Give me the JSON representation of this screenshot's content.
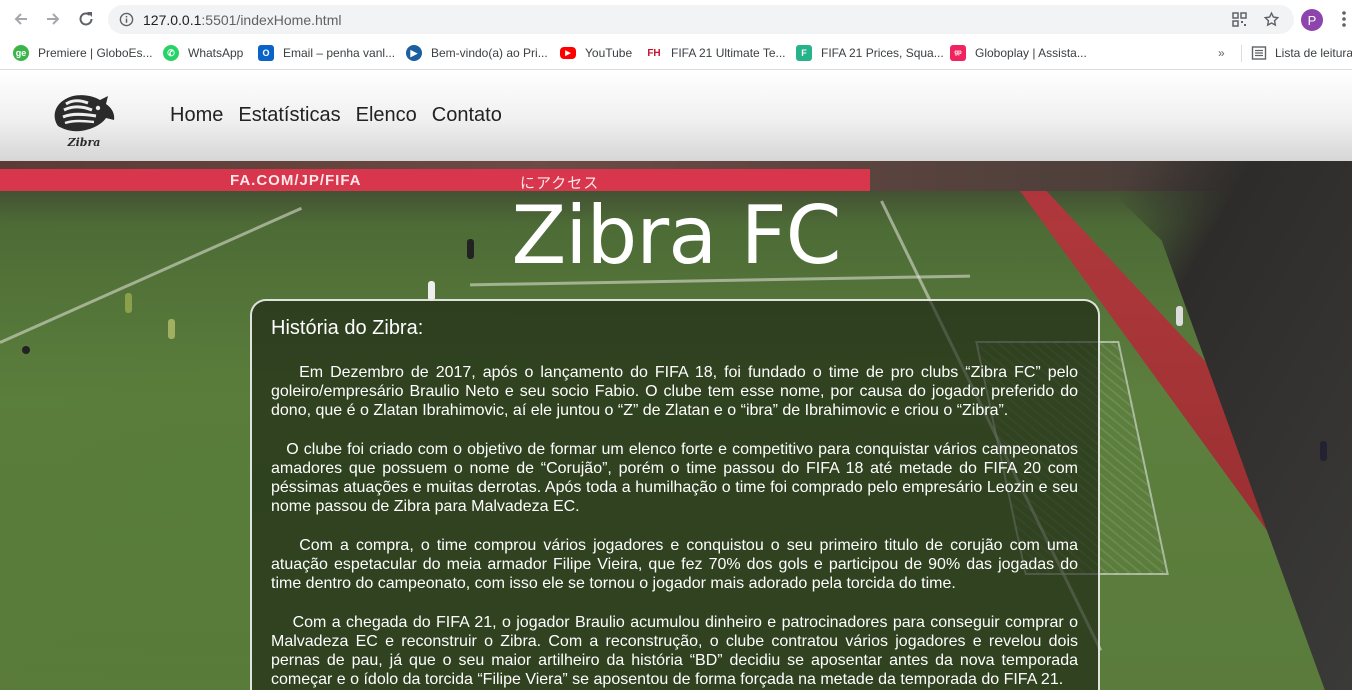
{
  "browser": {
    "url_host": "127.0.0.1",
    "url_path": ":5501/indexHome.html",
    "profile_initial": "P",
    "bookmarks": [
      {
        "label": "Premiere | GloboEs...",
        "icon": "globoesporte-icon",
        "color": "#3bb54a"
      },
      {
        "label": "WhatsApp",
        "icon": "whatsapp-icon",
        "color": "#25d366"
      },
      {
        "label": "Email – penha vanl...",
        "icon": "outlook-icon",
        "color": "#0a64c8"
      },
      {
        "label": "Bem-vindo(a) ao Pri...",
        "icon": "prime-video-icon",
        "color": "#1a5f9e"
      },
      {
        "label": "YouTube",
        "icon": "youtube-icon",
        "color": "#ff0000"
      },
      {
        "label": "FIFA 21 Ultimate Te...",
        "icon": "futhead-icon",
        "color": "#c8102e"
      },
      {
        "label": "FIFA 21 Prices, Squa...",
        "icon": "futbin-icon",
        "color": "#27b38a"
      },
      {
        "label": "Globoplay | Assista...",
        "icon": "globoplay-icon",
        "color": "#f0235e"
      }
    ],
    "reading_list": "Lista de leitura"
  },
  "site": {
    "logo_text": "Zibra",
    "menu": [
      "Home",
      "Estatísticas",
      "Elenco",
      "Contato"
    ],
    "hero_title": "Zibra FC",
    "adboard": [
      "FA.COM/JP/FIFA",
      "にアクセス"
    ],
    "card": {
      "heading": "História do Zibra:",
      "paragraphs": [
        "    Em Dezembro de 2017, após o lançamento do FIFA 18, foi fundado o time de pro clubs “Zibra FC” pelo goleiro/empresário Braulio Neto e seu socio Fabio. O clube tem esse nome, por causa do jogador preferido do dono, que é o Zlatan Ibrahimovic, aí ele juntou o “Z” de Zlatan e o “ibra” de Ibrahimovic e criou o “Zibra”.",
        "   O clube foi criado com o objetivo de formar um elenco forte e competitivo para conquistar vários campeonatos amadores que possuem o nome de “Corujão”, porém o time passou do FIFA 18 até metade do FIFA 20 com péssimas atuações e muitas derrotas. Após toda a humilhação o time foi comprado pelo empresário Leozin e seu nome passou de Zibra para Malvadeza EC.",
        "    Com a compra, o time comprou vários jogadores e conquistou o seu primeiro titulo de corujão com uma atuação espetacular do meia armador Filipe Vieira, que fez 70% dos gols e participou de 90% das jogadas do time dentro do campeonato, com isso ele se tornou o jogador mais adorado pela torcida do time.",
        "    Com a chegada do FIFA 21, o jogador Braulio acumulou dinheiro e patrocinadores para conseguir comprar o Malvadeza EC e reconstruir o Zibra. Com a reconstrução, o clube contratou vários jogadores e revelou dois pernas de pau, já que o seu maior artilheiro da história “BD” decidiu se aposentar antes da nova temporada começar e o ídolo da torcida “Filipe Viera” se aposentou de forma forçada na metade da temporada do FIFA 21."
      ]
    }
  }
}
